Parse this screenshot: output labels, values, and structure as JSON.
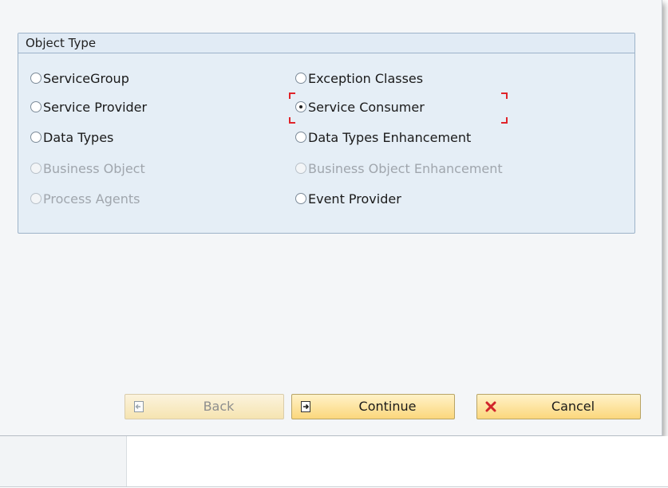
{
  "group": {
    "title": "Object Type"
  },
  "options": [
    {
      "label": "ServiceGroup",
      "checked": false,
      "enabled": true
    },
    {
      "label": "Service Provider",
      "checked": false,
      "enabled": true
    },
    {
      "label": "Data Types",
      "checked": false,
      "enabled": true
    },
    {
      "label": "Business Object",
      "checked": false,
      "enabled": false
    },
    {
      "label": "Process Agents",
      "checked": false,
      "enabled": false
    },
    {
      "label": "Exception Classes",
      "checked": false,
      "enabled": true
    },
    {
      "label": "Service Consumer",
      "checked": true,
      "enabled": true
    },
    {
      "label": "Data Types Enhancement",
      "checked": false,
      "enabled": true
    },
    {
      "label": "Business Object Enhancement",
      "checked": false,
      "enabled": false
    },
    {
      "label": "Event Provider",
      "checked": false,
      "enabled": true
    }
  ],
  "buttons": {
    "back": {
      "label": "Back",
      "icon": "back-page-icon",
      "enabled": false
    },
    "continue": {
      "label": "Continue",
      "icon": "continue-page-icon",
      "enabled": true
    },
    "cancel": {
      "label": "Cancel",
      "icon": "cancel-x-icon",
      "enabled": true
    }
  },
  "colors": {
    "focus": "#e0242a",
    "button_gold": "#fbd77c",
    "group_bg": "#e5eef6",
    "cancel_x": "#d1262b"
  }
}
